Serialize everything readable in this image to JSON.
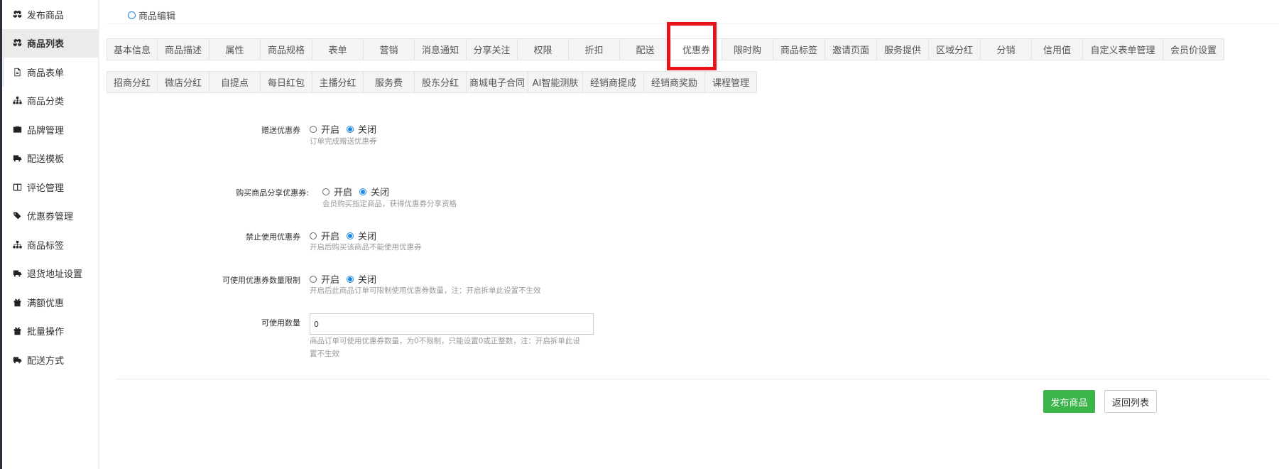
{
  "sidebar": {
    "items": [
      {
        "label": "发布商品",
        "icon": "cubes-icon"
      },
      {
        "label": "商品列表",
        "icon": "cubes-icon"
      },
      {
        "label": "商品表单",
        "icon": "file-icon"
      },
      {
        "label": "商品分类",
        "icon": "sitemap-icon"
      },
      {
        "label": "品牌管理",
        "icon": "briefcase-icon"
      },
      {
        "label": "配送模板",
        "icon": "truck-icon"
      },
      {
        "label": "评论管理",
        "icon": "columns-icon"
      },
      {
        "label": "优惠券管理",
        "icon": "tags-icon"
      },
      {
        "label": "商品标签",
        "icon": "sitemap-icon"
      },
      {
        "label": "退货地址设置",
        "icon": "truck-icon"
      },
      {
        "label": "满额优惠",
        "icon": "gift-icon"
      },
      {
        "label": "批量操作",
        "icon": "gift-icon"
      },
      {
        "label": "配送方式",
        "icon": "truck-icon"
      }
    ]
  },
  "breadcrumb": {
    "label": "商品编辑"
  },
  "tabs_row1": [
    "基本信息",
    "商品描述",
    "属性",
    "商品规格",
    "表单",
    "营销",
    "消息通知",
    "分享关注",
    "权限",
    "折扣",
    "配送",
    "优惠券",
    "限时购",
    "商品标签",
    "邀请页面",
    "服务提供",
    "区域分红",
    "分销",
    "信用值",
    "自定义表单管理",
    "会员价设置"
  ],
  "tabs_row2": [
    "招商分红",
    "微店分红",
    "自提点",
    "每日红包",
    "主播分红",
    "服务费",
    "股东分红",
    "商城电子合同",
    "AI智能测肤",
    "经销商提成",
    "经销商奖励",
    "课程管理"
  ],
  "active_tab": "优惠券",
  "form": {
    "gift_coupon": {
      "label": "赠送优惠券",
      "on": "开启",
      "off": "关闭",
      "help": "订单完成赠送优惠券"
    },
    "share_coupon": {
      "label": "购买商品分享优惠券:",
      "on": "开启",
      "off": "关闭",
      "help": "会员购买指定商品，获得优惠券分享资格"
    },
    "forbid_coupon": {
      "label": "禁止使用优惠券",
      "on": "开启",
      "off": "关闭",
      "help": "开启后购买该商品不能使用优惠券"
    },
    "limit_coupon": {
      "label": "可使用优惠券数量限制",
      "on": "开启",
      "off": "关闭",
      "help": "开启后此商品订单可限制使用优惠券数量，注：开启拆单此设置不生效"
    },
    "usable_count": {
      "label": "可使用数量",
      "value": "0",
      "help1": "商品订单可使用优惠券数量，为0不限制，只能设置0或正整数，注：开启拆单此设",
      "help2": "置不生效"
    }
  },
  "buttons": {
    "publish": "发布商品",
    "back": "返回列表"
  },
  "colors": {
    "primary": "#3bb54a",
    "highlight": "#e8141b",
    "radio": "#1e88e5"
  }
}
